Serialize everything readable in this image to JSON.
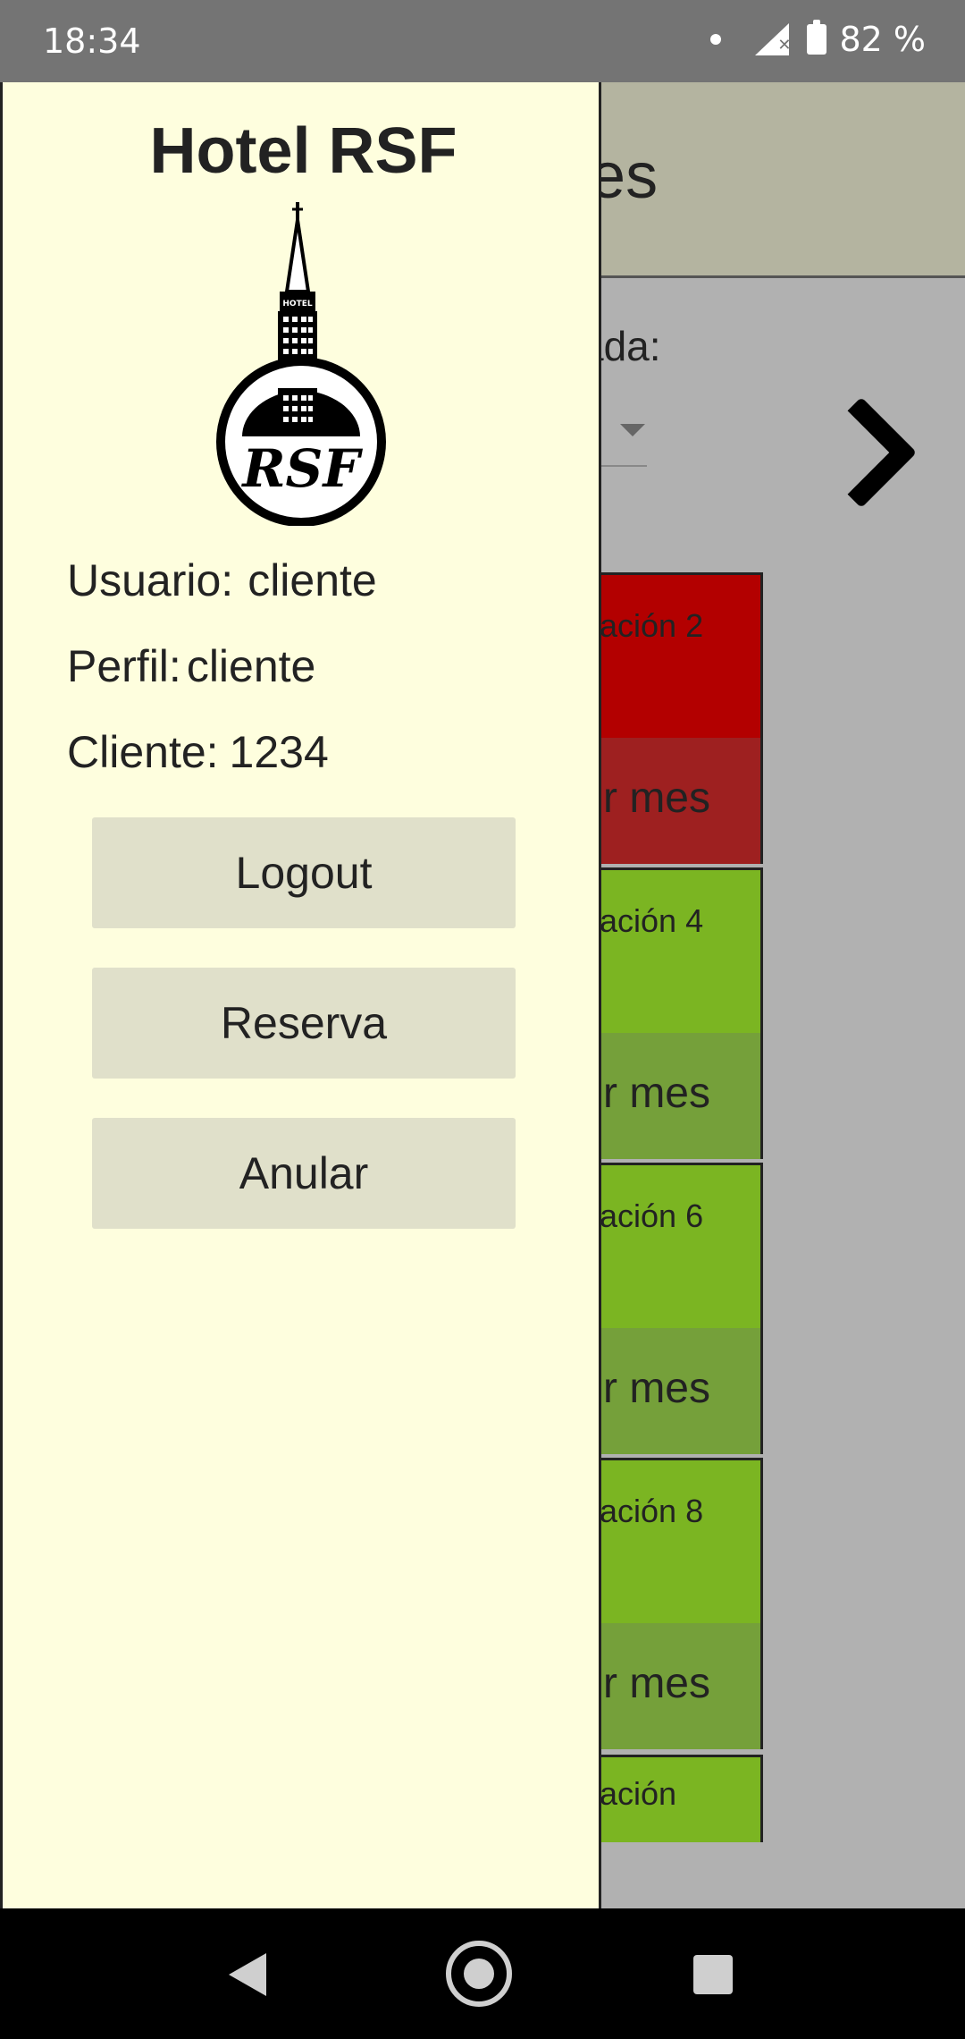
{
  "status_bar": {
    "time": "18:34",
    "battery": "82 %",
    "icons": [
      "notification-dot",
      "signal-no-service-icon",
      "battery-icon"
    ]
  },
  "background_app": {
    "header_title_partial": "nes",
    "date_label_partial": "ada:",
    "next_button_icon": "chevron-right-icon",
    "rooms": [
      {
        "name_partial": "ación 2",
        "button_partial": "r mes",
        "status_color": "#b30000"
      },
      {
        "name_partial": "ación 4",
        "button_partial": "r mes",
        "status_color": "#7bb522"
      },
      {
        "name_partial": "ación 6",
        "button_partial": "r mes",
        "status_color": "#7bb522"
      },
      {
        "name_partial": "ación 8",
        "button_partial": "r mes",
        "status_color": "#7bb522"
      }
    ],
    "partial_room_name": "ación"
  },
  "drawer": {
    "title": "Hotel RSF",
    "logo": "hotel-rsf-logo",
    "logo_text": "RSF",
    "logo_sign": "HOTEL",
    "user_label": "Usuario:",
    "user_value": "cliente",
    "profile_label": "Perfil:",
    "profile_value": "cliente",
    "client_label": "Cliente:",
    "client_value": "1234",
    "buttons": {
      "logout": "Logout",
      "reserve": "Reserva",
      "cancel": "Anular"
    }
  },
  "colors": {
    "drawer_bg": "#fefede",
    "button_bg": "#e0e0ca",
    "occupied": "#b30000",
    "available": "#7bb522"
  }
}
